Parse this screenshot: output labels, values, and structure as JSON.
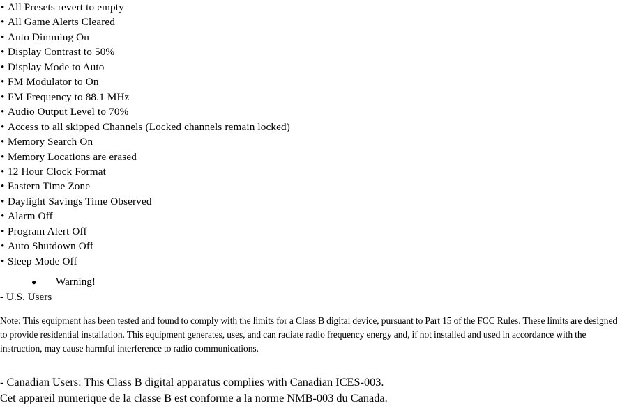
{
  "document": {
    "background_color": "#ffffff",
    "text_color": "#000000"
  },
  "settings_list": {
    "bullet_glyph": "•",
    "items": [
      "All Presets revert to empty",
      "All Game Alerts Cleared",
      "Auto Dimming On",
      "Display Contrast to 50%",
      "Display Mode to Auto",
      "FM Modulator to On",
      "FM Frequency to 88.1 MHz",
      "Audio Output Level to 70%",
      "Access to all skipped Channels (Locked channels remain locked)",
      "Memory Search On",
      "Memory Locations are erased",
      "12 Hour Clock Format",
      "Eastern Time Zone",
      "Daylight Savings Time Observed",
      "Alarm Off",
      "Program Alert Off",
      "Auto Shutdown Off",
      "Sleep Mode Off"
    ]
  },
  "warning": {
    "disc_glyph": "●",
    "heading": "Warning!",
    "us_users_line": "- U.S. Users",
    "fcc_note": "Note: This equipment has been tested and found to comply with the limits for a Class B digital device, pursuant to Part 15 of the FCC Rules. These limits are designed to provide residential installation. This equipment generates, uses, and can radiate radio frequency energy and, if not installed and used in accordance with the instruction, may cause harmful interference to radio communications."
  },
  "canada": {
    "line_english": "- Canadian Users: This Class B digital apparatus complies with Canadian ICES-003.",
    "line_french": "Cet appareil numerique de la classe B est conforme a la norme NMB-003 du Canada."
  }
}
